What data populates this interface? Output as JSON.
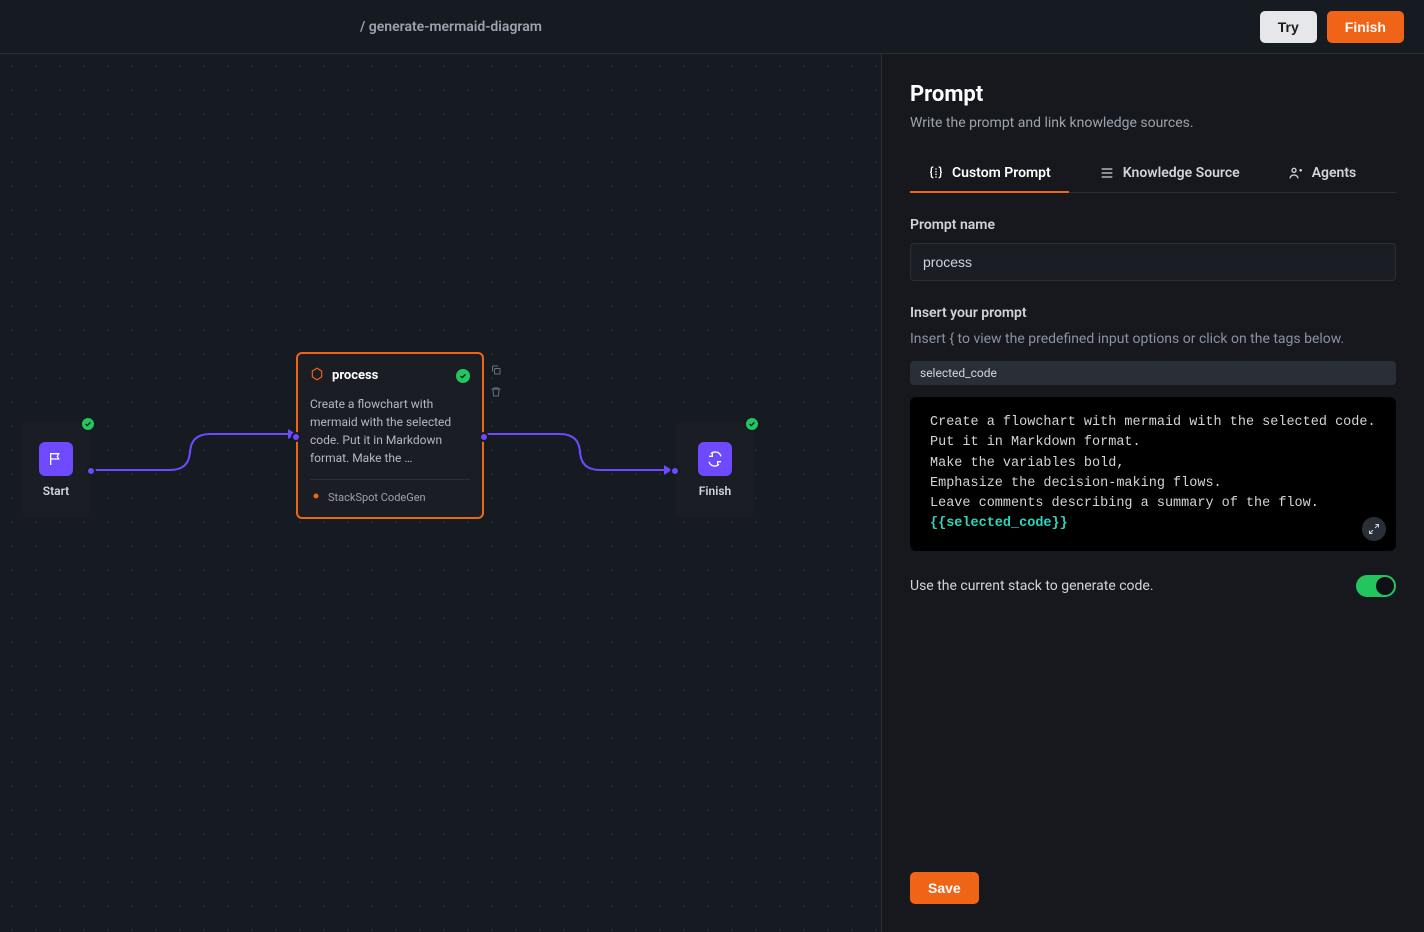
{
  "header": {
    "breadcrumb": "/ generate-mermaid-diagram",
    "try_label": "Try",
    "finish_label": "Finish"
  },
  "canvas": {
    "nodes": {
      "start": {
        "label": "Start"
      },
      "process": {
        "title": "process",
        "description": "Create a flowchart with mermaid with the selected code. Put it in Markdown format. Make the …",
        "model": "StackSpot CodeGen"
      },
      "finish": {
        "label": "Finish"
      }
    }
  },
  "panel": {
    "title": "Prompt",
    "subtitle": "Write the prompt and link knowledge sources.",
    "tabs": [
      {
        "label": "Custom Prompt",
        "active": true
      },
      {
        "label": "Knowledge Source",
        "active": false
      },
      {
        "label": "Agents",
        "active": false
      }
    ],
    "prompt_name_label": "Prompt name",
    "prompt_name_value": "process",
    "insert_label": "Insert your prompt",
    "insert_hint": "Insert { to view the predefined input options or click on the tags below.",
    "chip": "selected_code",
    "editor": {
      "lines": [
        "Create a flowchart with mermaid with the selected code.",
        "Put it in Markdown format.",
        "Make the variables bold,",
        "Emphasize the decision-making flows.",
        "Leave comments describing a summary of the flow."
      ],
      "variable": "{{selected_code}}"
    },
    "toggle_label": "Use the current stack to generate code.",
    "toggle_on": true,
    "save_label": "Save"
  }
}
